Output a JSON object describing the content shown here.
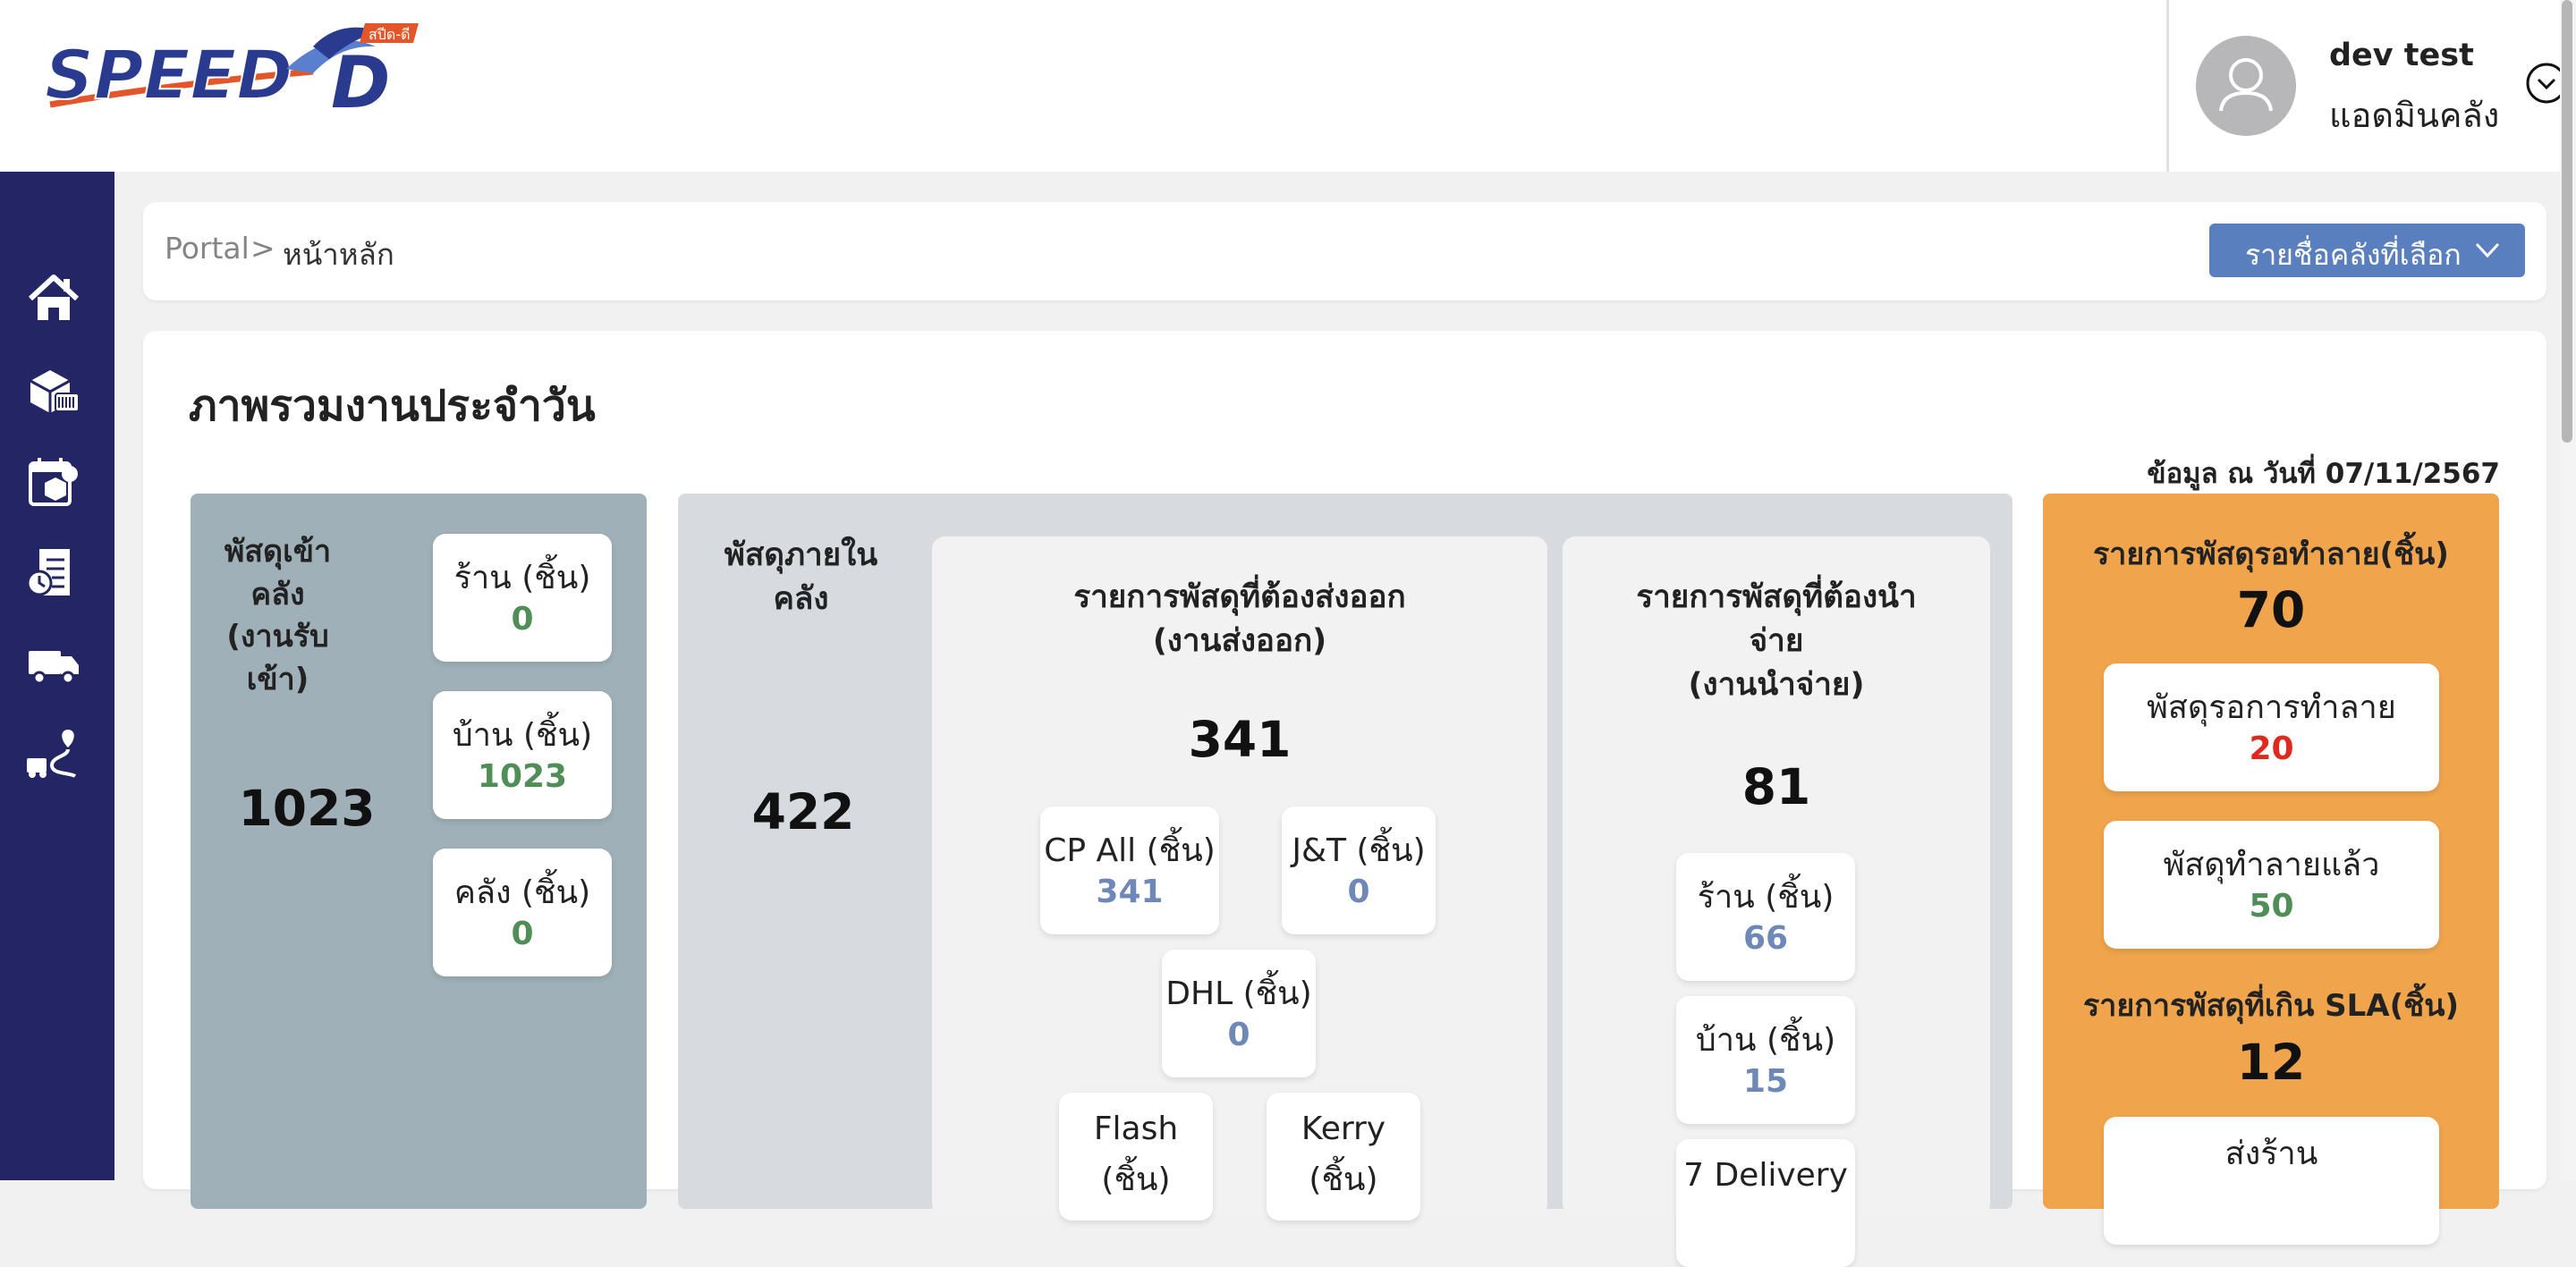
{
  "app": {
    "logo_text": "SPEED-D",
    "logo_sub": "สปีด-ดี"
  },
  "user": {
    "name": "dev test",
    "role": "แอดมินคลัง",
    "avatar_icon": "user-icon",
    "menu_icon": "chevron-down-circle-icon"
  },
  "sidebar": {
    "items": [
      {
        "icon": "home-icon"
      },
      {
        "icon": "parcel-scan-icon"
      },
      {
        "icon": "calendar-package-icon"
      },
      {
        "icon": "report-clock-icon"
      },
      {
        "icon": "delivery-truck-icon"
      },
      {
        "icon": "route-truck-icon"
      }
    ]
  },
  "breadcrumb": {
    "root": "Portal",
    "separator": ">",
    "current": "หน้าหลัก"
  },
  "warehouse_select": {
    "label": "รายชื่อคลังที่เลือก",
    "icon": "chevron-down-icon"
  },
  "dashboard": {
    "title": "ภาพรวมงานประจำวัน",
    "as_of": "ข้อมูล ณ วันที่ 07/11/2567",
    "inbound": {
      "label_line1": "พัสดุเข้าคลัง",
      "label_line2": "(งานรับเข้า)",
      "total": "1023",
      "cards": [
        {
          "label": "ร้าน (ชิ้น)",
          "value": "0"
        },
        {
          "label": "บ้าน (ชิ้น)",
          "value": "1023"
        },
        {
          "label": "คลัง (ชิ้น)",
          "value": "0"
        }
      ]
    },
    "in_warehouse": {
      "label_line1": "พัสดุภายใน",
      "label_line2": "คลัง",
      "total": "422"
    },
    "outbound": {
      "label_line1": "รายการพัสดุที่ต้องส่งออก",
      "label_line2": "(งานส่งออก)",
      "total": "341",
      "cards": [
        {
          "label": "CP All (ชิ้น)",
          "value": "341"
        },
        {
          "label": "J&T (ชิ้น)",
          "value": "0"
        },
        {
          "label": "DHL (ชิ้น)",
          "value": "0"
        },
        {
          "label": "Flash",
          "label2": "(ชิ้น)"
        },
        {
          "label": "Kerry",
          "label2": "(ชิ้น)"
        }
      ]
    },
    "distribution": {
      "label_line1": "รายการพัสดุที่ต้องนำ",
      "label_line2": "จ่าย",
      "label_line3": "(งานนำจ่าย)",
      "total": "81",
      "cards": [
        {
          "label": "ร้าน (ชิ้น)",
          "value": "66"
        },
        {
          "label": "บ้าน (ชิ้น)",
          "value": "15"
        },
        {
          "label": "7 Delivery"
        }
      ]
    },
    "destroy": {
      "label": "รายการพัสดุรอทำลาย(ชิ้น)",
      "total": "70",
      "cards": [
        {
          "label": "พัสดุรอการทำลาย",
          "value": "20"
        },
        {
          "label": "พัสดุทำลายแล้ว",
          "value": "50"
        }
      ],
      "sla_label": "รายการพัสดุที่เกิน SLA(ชิ้น)",
      "sla_total": "12",
      "sla_cards": [
        {
          "label": "ส่งร้าน"
        }
      ]
    }
  }
}
